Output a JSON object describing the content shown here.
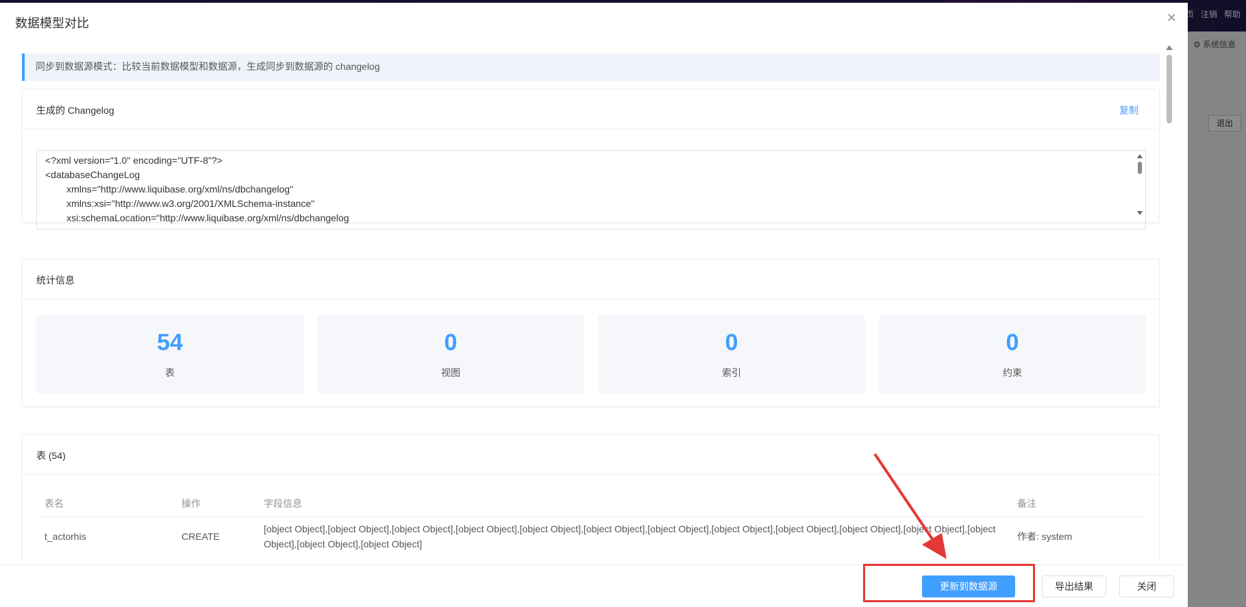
{
  "background": {
    "top_menu": [
      "页",
      "注销",
      "帮助"
    ],
    "system_info": "系统信息",
    "exit_button": "退出"
  },
  "dialog": {
    "title": "数据模型对比",
    "alert": "同步到数据源模式：比较当前数据模型和数据源，生成同步到数据源的 changelog",
    "changelog": {
      "title": "生成的 Changelog",
      "copy_label": "复制",
      "content": "<?xml version=\"1.0\" encoding=\"UTF-8\"?>\n<databaseChangeLog\n        xmlns=\"http://www.liquibase.org/xml/ns/dbchangelog\"\n        xmlns:xsi=\"http://www.w3.org/2001/XMLSchema-instance\"\n        xsi:schemaLocation=\"http://www.liquibase.org/xml/ns/dbchangelog"
    },
    "stats": {
      "title": "统计信息",
      "items": [
        {
          "value": "54",
          "label": "表"
        },
        {
          "value": "0",
          "label": "视图"
        },
        {
          "value": "0",
          "label": "索引"
        },
        {
          "value": "0",
          "label": "约束"
        }
      ]
    },
    "tables": {
      "title": "表 (54)",
      "columns": [
        "表名",
        "操作",
        "字段信息",
        "备注"
      ],
      "rows": [
        {
          "name": "t_actorhis",
          "operation": "CREATE",
          "fields": "[object Object],[object Object],[object Object],[object Object],[object Object],[object Object],[object Object],[object Object],[object Object],[object Object],[object Object],[object Object],[object Object],[object Object]",
          "remark": "作者: system"
        }
      ]
    },
    "footer": {
      "update_label": "更新到数据源",
      "export_label": "导出结果",
      "close_label": "关闭"
    }
  }
}
